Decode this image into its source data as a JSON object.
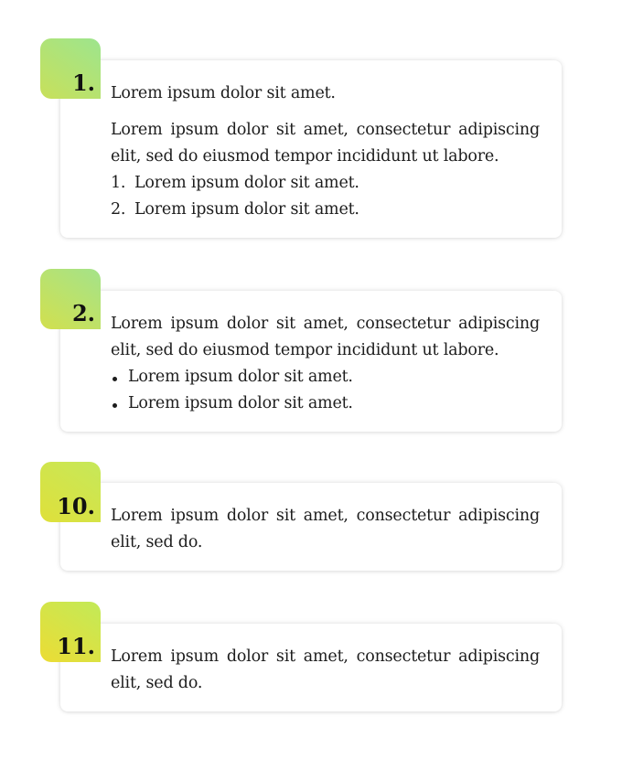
{
  "items": [
    {
      "number": "1.",
      "lead": "Lorem ipsum dolor sit amet.",
      "paragraph": "Lorem ipsum dolor sit amet, consectetur adipiscing elit, sed do eiusmod tempor incididunt ut labore.",
      "list_type": "ordered",
      "list": [
        {
          "marker": "1.",
          "text": "Lorem ipsum dolor sit amet."
        },
        {
          "marker": "2.",
          "text": "Lorem ipsum dolor sit amet."
        }
      ],
      "gradient": [
        "#9de58e",
        "#c8e05a"
      ]
    },
    {
      "number": "2.",
      "paragraph": "Lorem ipsum dolor sit amet, consectetur adipiscing elit, sed do eiusmod tempor incididunt ut labore.",
      "list_type": "bullet",
      "list": [
        {
          "text": "Lorem ipsum dolor sit amet."
        },
        {
          "text": "Lorem ipsum dolor sit amet."
        }
      ],
      "gradient": [
        "#a4e38a",
        "#d2e04e"
      ]
    },
    {
      "number": "10.",
      "paragraph": "Lorem ipsum dolor sit amet, consectetur adipiscing elit, sed do.",
      "gradient": [
        "#c6e85a",
        "#dfe03a"
      ]
    },
    {
      "number": "11.",
      "paragraph": "Lorem ipsum dolor sit amet, consectetur adipiscing elit, sed do.",
      "gradient": [
        "#c2ea58",
        "#ecdc34"
      ]
    }
  ]
}
